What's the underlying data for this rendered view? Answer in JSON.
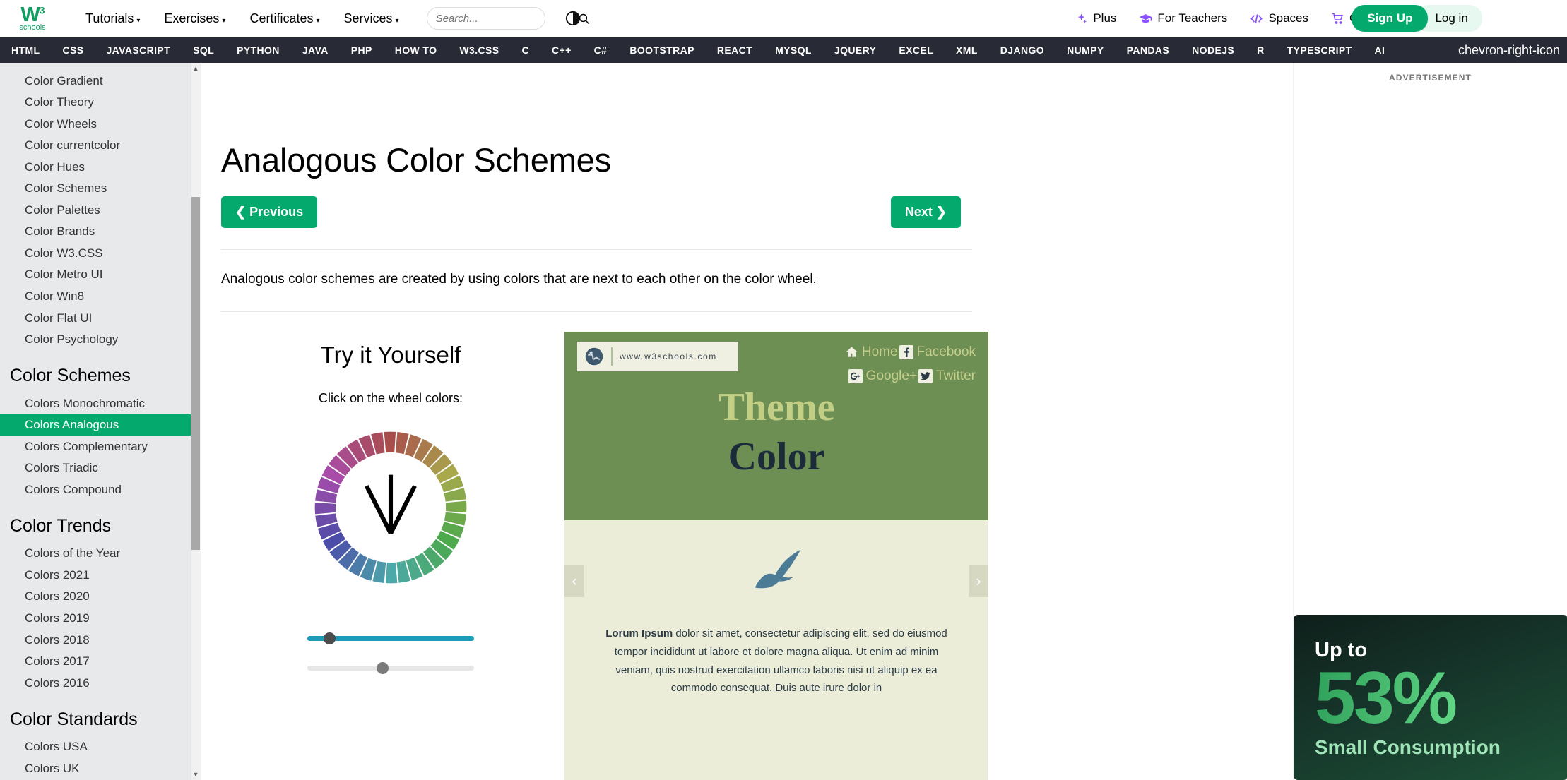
{
  "header": {
    "logo": {
      "main": "W",
      "sup": "3",
      "sub": "schools"
    },
    "nav": [
      {
        "label": "Tutorials",
        "caret": "▾"
      },
      {
        "label": "Exercises",
        "caret": "▾"
      },
      {
        "label": "Certificates",
        "caret": "▾"
      },
      {
        "label": "Services",
        "caret": "▾"
      }
    ],
    "search": {
      "placeholder": "Search...",
      "value": "",
      "icon": "search-icon"
    },
    "contrast_icon": "contrast-toggle-icon",
    "right_links": [
      {
        "label": "Plus",
        "icon": "sparkle-icon"
      },
      {
        "label": "For Teachers",
        "icon": "graduation-cap-icon"
      },
      {
        "label": "Spaces",
        "icon": "code-brackets-icon"
      },
      {
        "label": "Get Certified",
        "icon": "shopping-cart-icon"
      }
    ],
    "signup_label": "Sign Up",
    "login_label": "Log in",
    "accent_green": "#04AA6D",
    "accent_purple": "#8A4FFF"
  },
  "langnav": {
    "items": [
      "HTML",
      "CSS",
      "JAVASCRIPT",
      "SQL",
      "PYTHON",
      "JAVA",
      "PHP",
      "HOW TO",
      "W3.CSS",
      "C",
      "C++",
      "C#",
      "BOOTSTRAP",
      "REACT",
      "MYSQL",
      "JQUERY",
      "EXCEL",
      "XML",
      "DJANGO",
      "NUMPY",
      "PANDAS",
      "NODEJS",
      "R",
      "TYPESCRIPT",
      "AI"
    ],
    "scroll_right_icon": "chevron-right-icon",
    "background": "#282A35"
  },
  "sidebar": {
    "groups": [
      {
        "heading": "",
        "items": [
          "Color Gradient",
          "Color Theory",
          "Color Wheels",
          "Color currentcolor",
          "Color Hues",
          "Color Schemes",
          "Color Palettes",
          "Color Brands",
          "Color W3.CSS",
          "Color Metro UI",
          "Color Win8",
          "Color Flat UI",
          "Color Psychology"
        ]
      },
      {
        "heading": "Color Schemes",
        "items": [
          "Colors Monochromatic",
          "Colors Analogous",
          "Colors Complementary",
          "Colors Triadic",
          "Colors Compound"
        ]
      },
      {
        "heading": "Color Trends",
        "items": [
          "Colors of the Year",
          "Colors 2021",
          "Colors 2020",
          "Colors 2019",
          "Colors 2018",
          "Colors 2017",
          "Colors 2016"
        ]
      },
      {
        "heading": "Color Standards",
        "items": [
          "Colors USA",
          "Colors UK"
        ]
      }
    ],
    "active_item": "Colors Analogous",
    "active_color": "#04AA6D",
    "scrollbar": {
      "up_icon": "▲",
      "down_icon": "▼"
    }
  },
  "main": {
    "title": "Analogous Color Schemes",
    "prev_label": "Previous",
    "prev_icon": "❮",
    "next_label": "Next",
    "next_icon": "❯",
    "intro": "Analogous color schemes are created by using colors that are next to each other on the color wheel.",
    "tryit": {
      "heading": "Try it Yourself",
      "hint": "Click on the wheel colors:",
      "wheel_icon": "color-wheel",
      "sliders": [
        {
          "name": "saturation-slider",
          "value": 13,
          "filled": true,
          "color": "#1d9bb8"
        },
        {
          "name": "lightness-slider",
          "value": 45,
          "filled": false,
          "color": "#e6e6e6"
        }
      ]
    },
    "preview": {
      "url": "www.w3schools.com",
      "globe_icon": "globe-icon",
      "links": [
        {
          "label": "Home",
          "icon": "home-icon"
        },
        {
          "label": "Facebook",
          "icon": "facebook-icon"
        },
        {
          "label": "Google+",
          "icon": "googleplus-icon"
        },
        {
          "label": "Twitter",
          "icon": "twitter-icon"
        }
      ],
      "title_top": "Theme",
      "title_bottom": "Color",
      "prev_arrow": "‹",
      "next_arrow": "›",
      "feather_icon": "feather-quill-icon",
      "body_lead": "Lorum Ipsum",
      "body_text": " dolor sit amet, consectetur adipiscing elit, sed do eiusmod tempor incididunt ut labore et dolore magna aliqua. Ut enim ad minim veniam, quis nostrud exercitation ullamco laboris nisi ut aliquip ex ea commodo consequat. Duis aute irure dolor in",
      "theme_green": "#6E8F53",
      "theme_cream": "#EBEDD9",
      "theme_navy": "#1C2B3A",
      "theme_olive": "#C3CF85"
    }
  },
  "ads": {
    "label": "ADVERTISEMENT",
    "banner": {
      "line1": "Up to",
      "percent": "53%",
      "line3": "Small Consumption"
    }
  }
}
